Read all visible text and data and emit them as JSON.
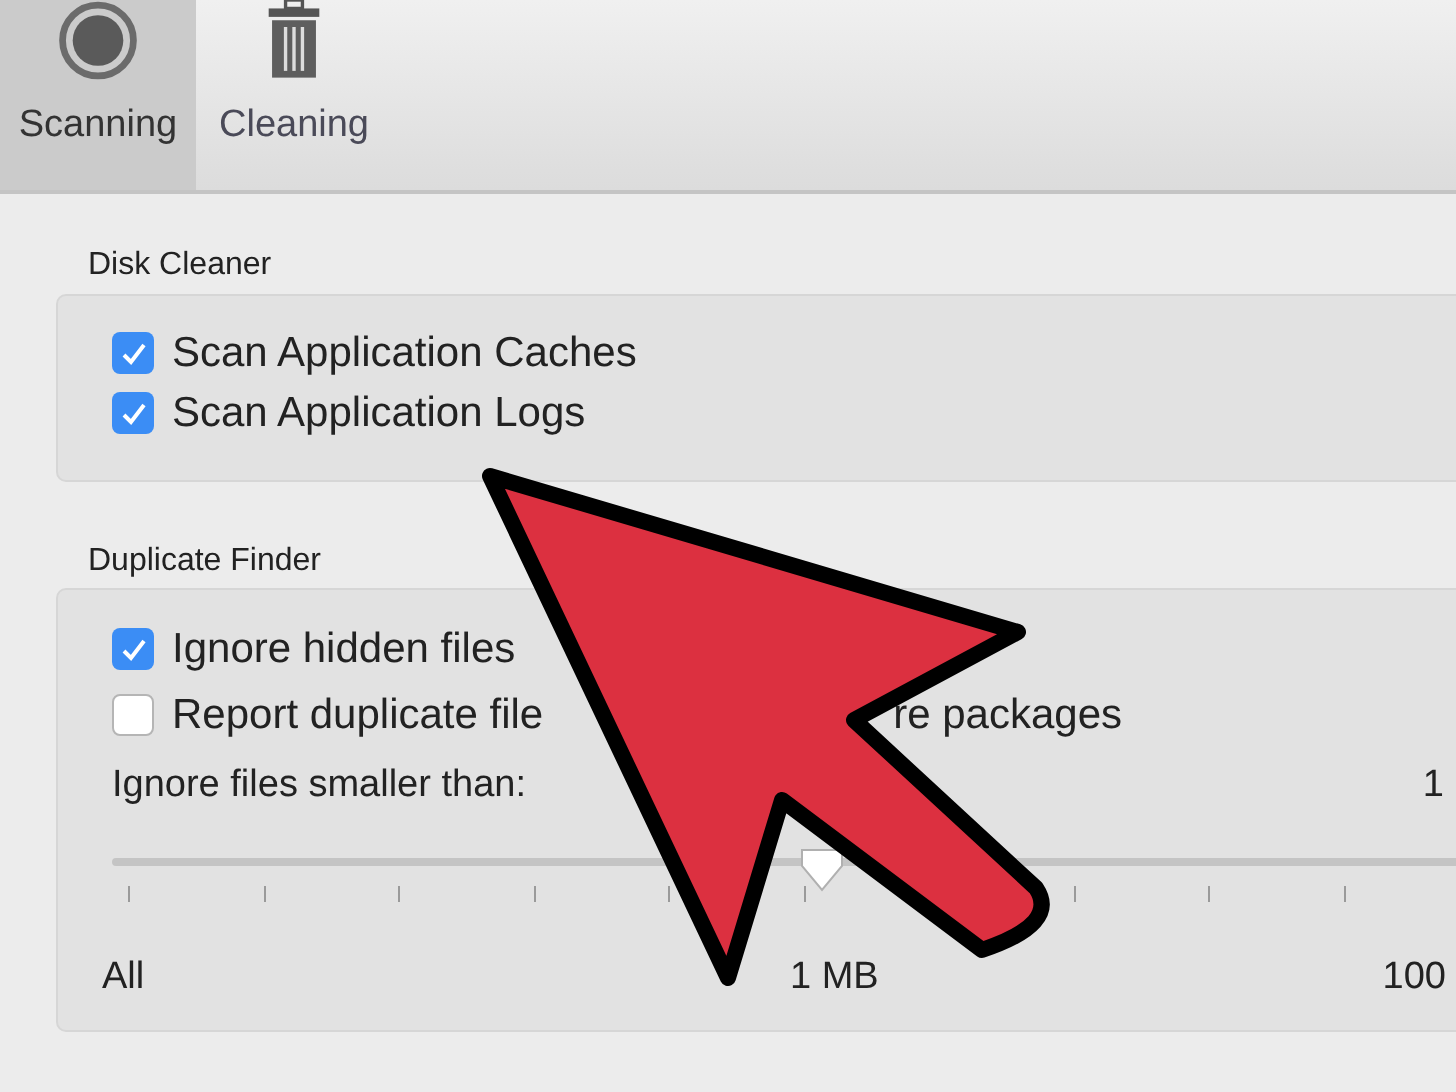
{
  "toolbar": {
    "tabs": [
      {
        "label": "Scanning",
        "kind": "scan",
        "selected": true
      },
      {
        "label": "Cleaning",
        "kind": "trash",
        "selected": false
      }
    ]
  },
  "disk_cleaner": {
    "title": "Disk Cleaner",
    "options": [
      {
        "label": "Scan Application Caches",
        "checked": true
      },
      {
        "label": "Scan Application Logs",
        "checked": true
      }
    ]
  },
  "duplicate_finder": {
    "title": "Duplicate Finder",
    "options": [
      {
        "label": "Ignore hidden files",
        "checked": true
      },
      {
        "label": "Report duplicate file",
        "label_after": "re packages",
        "checked": false
      }
    ],
    "size_label": "Ignore files smaller than:",
    "size_value": "1",
    "slider": {
      "level": 0.5,
      "labels": [
        "All",
        "1 MB",
        "100"
      ]
    }
  }
}
